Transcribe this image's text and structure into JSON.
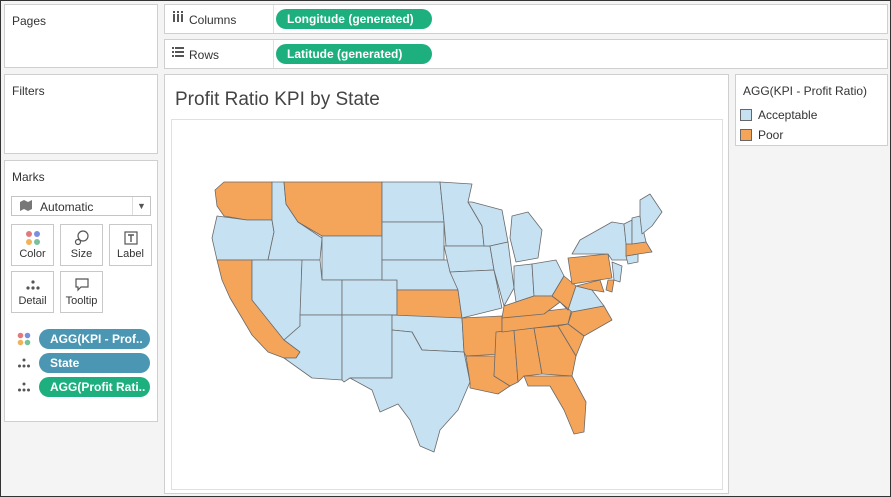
{
  "pages_panel": {
    "title": "Pages"
  },
  "filters_panel": {
    "title": "Filters"
  },
  "columns_shelf": {
    "label": "Columns",
    "icon": "columns-icon",
    "pill": "Longitude (generated)"
  },
  "rows_shelf": {
    "label": "Rows",
    "icon": "rows-icon",
    "pill": "Latitude (generated)"
  },
  "marks": {
    "title": "Marks",
    "mark_type": "Automatic",
    "buttons": [
      {
        "label": "Color",
        "icon": "color-icon"
      },
      {
        "label": "Size",
        "icon": "size-icon"
      },
      {
        "label": "Label",
        "icon": "label-icon"
      },
      {
        "label": "Detail",
        "icon": "detail-icon"
      },
      {
        "label": "Tooltip",
        "icon": "tooltip-icon"
      }
    ],
    "fields": [
      {
        "label": "AGG(KPI - Prof..",
        "icon": "color-icon",
        "color": "#4a96b3"
      },
      {
        "label": "State",
        "icon": "detail-icon",
        "color": "#4a96b3"
      },
      {
        "label": "AGG(Profit Rati..",
        "icon": "detail-icon",
        "color": "#1db07e"
      }
    ]
  },
  "view": {
    "title": "Profit Ratio KPI by State"
  },
  "legend": {
    "title": "AGG(KPI - Profit Ratio)",
    "items": [
      {
        "label": "Acceptable",
        "color": "#c6e1f2"
      },
      {
        "label": "Poor",
        "color": "#f5a55a"
      }
    ]
  },
  "map": {
    "acceptable_color": "#c6e1f2",
    "poor_color": "#f5a55a",
    "poor_states": [
      "Washington",
      "Montana",
      "California",
      "Kansas",
      "Arkansas",
      "Louisiana",
      "Mississippi",
      "Alabama",
      "Georgia",
      "Florida",
      "Tennessee",
      "North Carolina",
      "South Carolina",
      "Kentucky",
      "West Virginia",
      "Pennsylvania",
      "Massachusetts",
      "Delaware",
      "Maryland"
    ]
  }
}
